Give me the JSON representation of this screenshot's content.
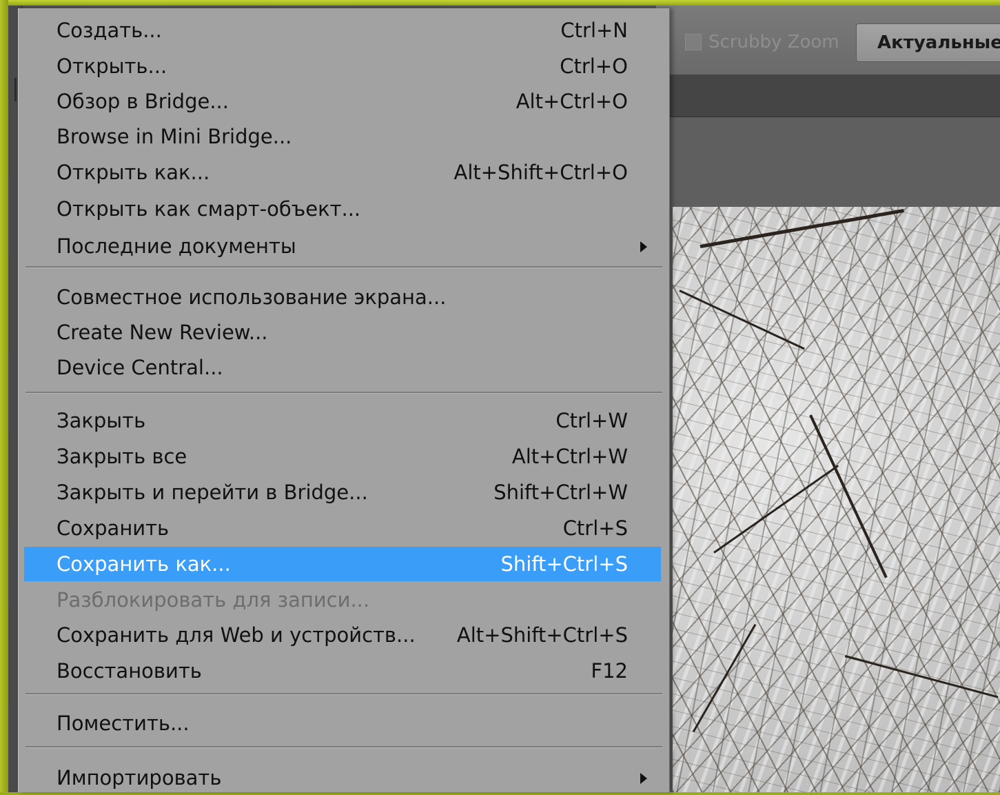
{
  "options_bar": {
    "scrubby_zoom_label": "Scrubby Zoom",
    "actual_pixels_label": "Актуальные п"
  },
  "file_menu": {
    "items": [
      {
        "label": "Создать...",
        "shortcut": "Ctrl+N"
      },
      {
        "label": "Открыть...",
        "shortcut": "Ctrl+O"
      },
      {
        "label": "Обзор в Bridge...",
        "shortcut": "Alt+Ctrl+O"
      },
      {
        "label": "Browse in Mini Bridge...",
        "shortcut": ""
      },
      {
        "label": "Открыть как...",
        "shortcut": "Alt+Shift+Ctrl+O"
      },
      {
        "label": "Открыть как смарт-объект...",
        "shortcut": ""
      },
      {
        "label": "Последние документы",
        "shortcut": "",
        "submenu": true
      },
      {
        "label": "Совместное использование экрана...",
        "shortcut": ""
      },
      {
        "label": "Create New Review...",
        "shortcut": ""
      },
      {
        "label": "Device Central...",
        "shortcut": ""
      },
      {
        "label": "Закрыть",
        "shortcut": "Ctrl+W"
      },
      {
        "label": "Закрыть все",
        "shortcut": "Alt+Ctrl+W"
      },
      {
        "label": "Закрыть и перейти в Bridge...",
        "shortcut": "Shift+Ctrl+W"
      },
      {
        "label": "Сохранить",
        "shortcut": "Ctrl+S"
      },
      {
        "label": "Сохранить как...",
        "shortcut": "Shift+Ctrl+S",
        "highlighted": true
      },
      {
        "label": "Разблокировать для записи...",
        "shortcut": "",
        "disabled": true
      },
      {
        "label": "Сохранить для Web и устройств...",
        "shortcut": "Alt+Shift+Ctrl+S"
      },
      {
        "label": "Восстановить",
        "shortcut": "F12"
      },
      {
        "label": "Поместить...",
        "shortcut": ""
      },
      {
        "label": "Импортировать",
        "shortcut": "",
        "submenu": true
      }
    ]
  },
  "colors": {
    "highlight": "#3a9df8",
    "menu_background": "#a2a2a2",
    "frame": "#9aab1c"
  }
}
